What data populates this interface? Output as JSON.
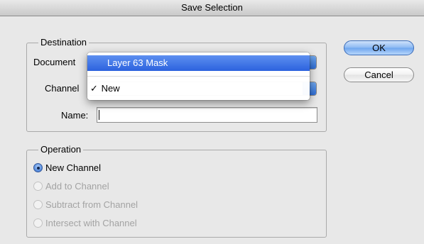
{
  "window": {
    "title": "Save Selection"
  },
  "destination": {
    "legend": "Destination",
    "document_label": "Document",
    "channel_label": "Channel",
    "name_label": "Name:",
    "name_value": ""
  },
  "menu": {
    "items": [
      {
        "label": "Layer 63 Mask",
        "highlighted": true,
        "checked": false
      },
      {
        "label": "New",
        "highlighted": false,
        "checked": true
      }
    ],
    "checkmark": "✓"
  },
  "buttons": {
    "ok": "OK",
    "cancel": "Cancel"
  },
  "operation": {
    "legend": "Operation",
    "options": [
      {
        "label": "New Channel",
        "selected": true,
        "enabled": true
      },
      {
        "label": "Add to Channel",
        "selected": false,
        "enabled": false
      },
      {
        "label": "Subtract from Channel",
        "selected": false,
        "enabled": false
      },
      {
        "label": "Intersect with Channel",
        "selected": false,
        "enabled": false
      }
    ]
  },
  "colors": {
    "accent": "#2f6fd8",
    "menu_highlight": "#3a6fe2"
  }
}
